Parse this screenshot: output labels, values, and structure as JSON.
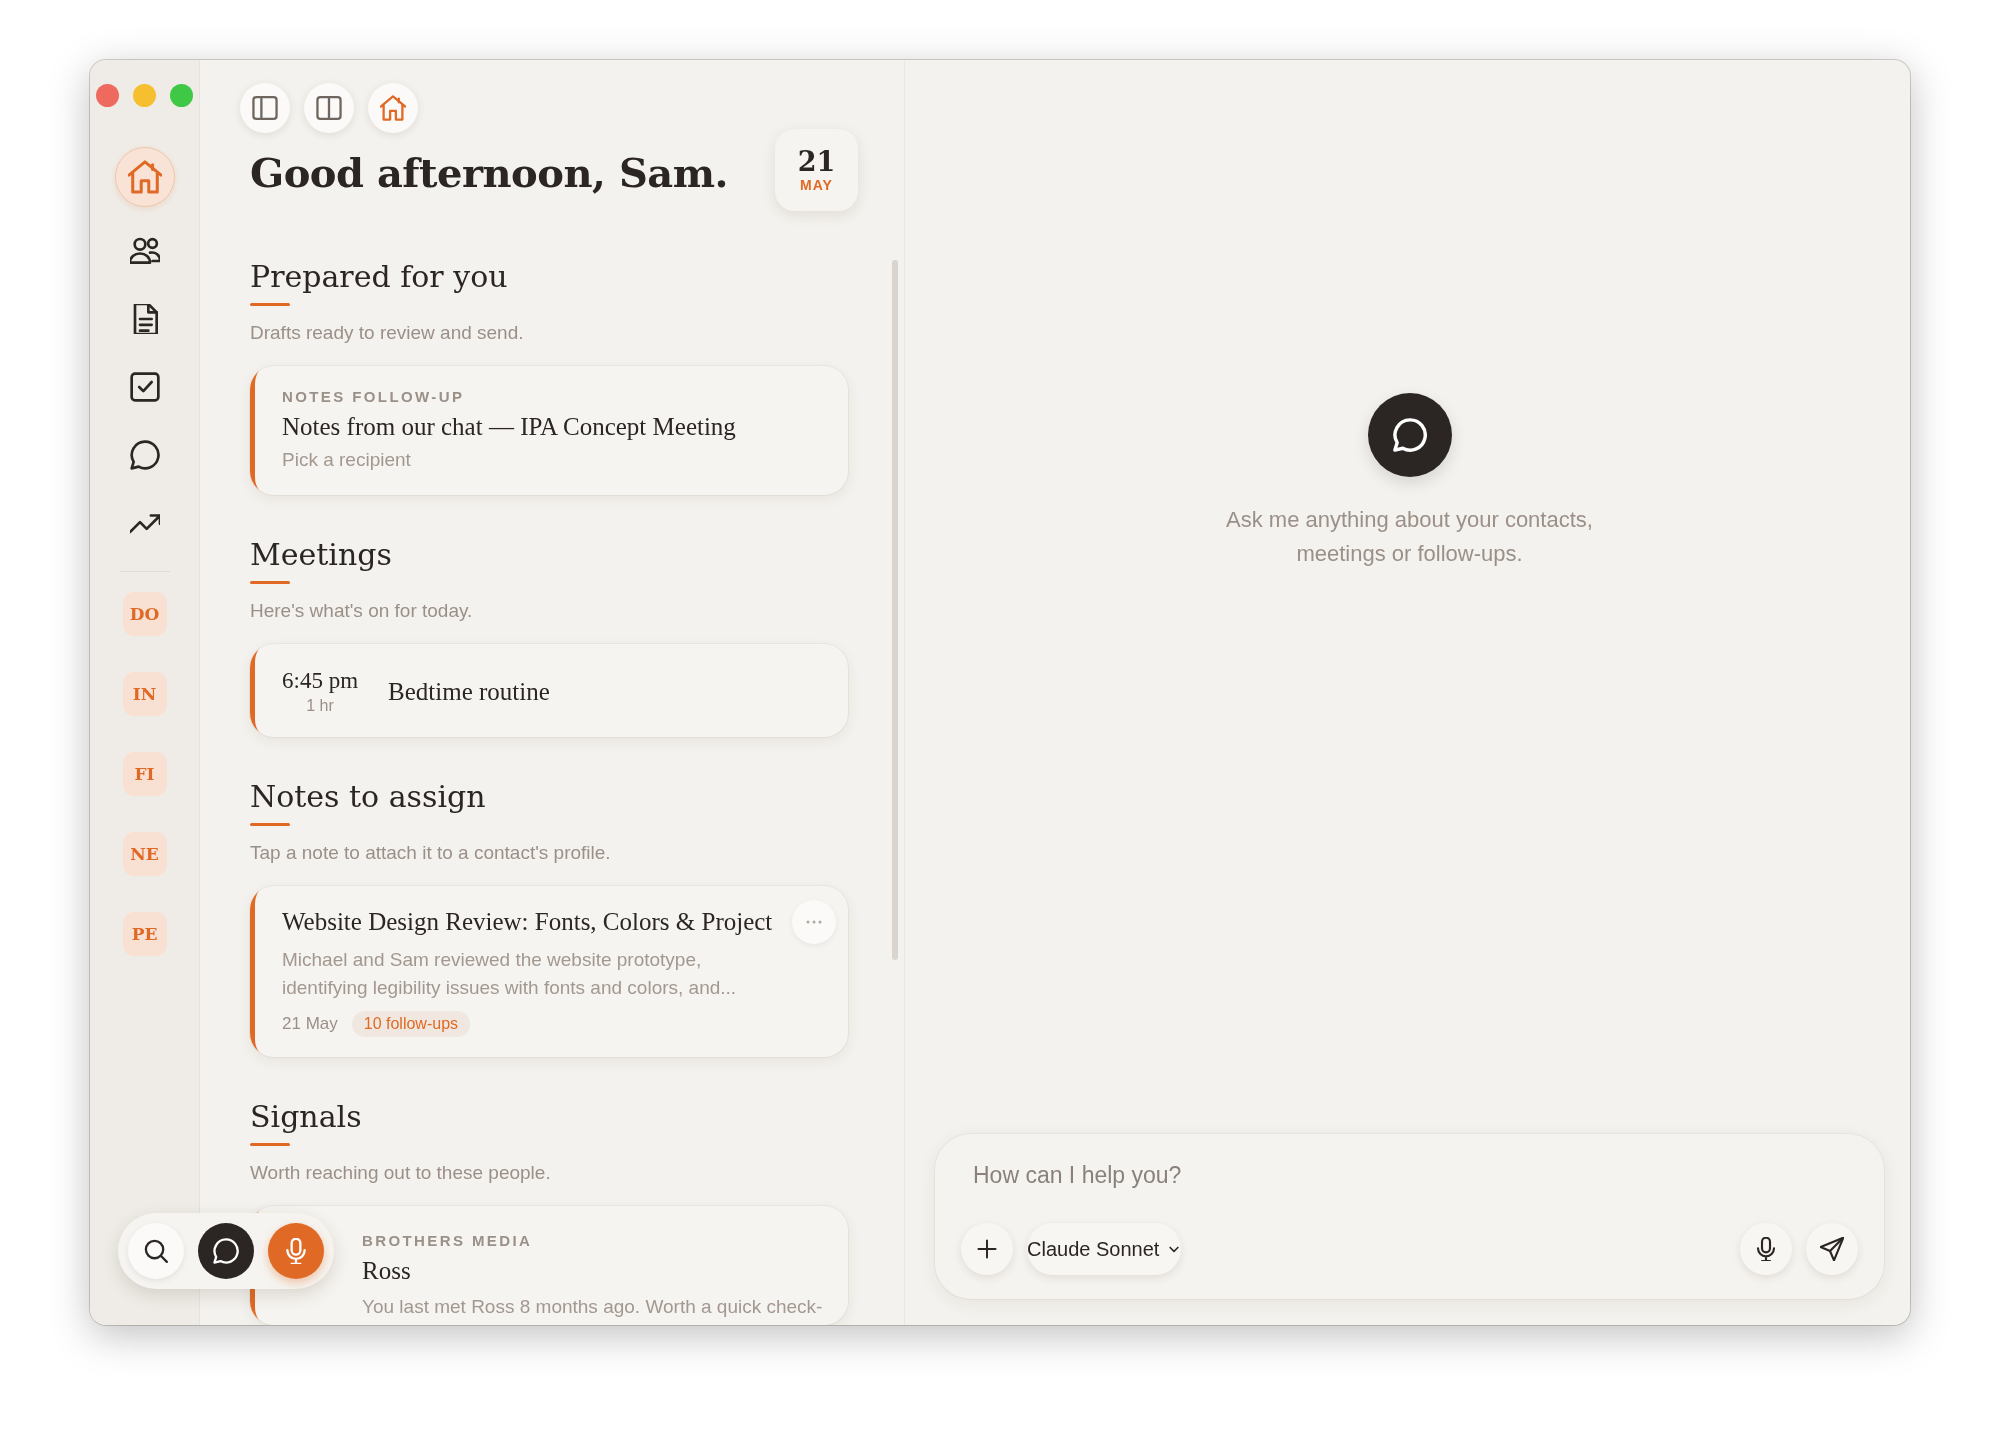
{
  "sidebar": {
    "nav": [
      {
        "kind": "home",
        "selected": true
      },
      {
        "kind": "contacts",
        "selected": false
      },
      {
        "kind": "notes",
        "selected": false
      },
      {
        "kind": "tasks",
        "selected": false
      },
      {
        "kind": "chat",
        "selected": false
      },
      {
        "kind": "trends",
        "selected": false
      }
    ],
    "contacts": [
      {
        "initials": "DO"
      },
      {
        "initials": "IN"
      },
      {
        "initials": "FI"
      },
      {
        "initials": "NE"
      },
      {
        "initials": "PE"
      }
    ]
  },
  "greeting": "Good afternoon, Sam.",
  "date": {
    "day": "21",
    "month": "MAY"
  },
  "sections": [
    {
      "title": "Prepared for you",
      "subtitle": "Drafts ready to review and send.",
      "cards": [
        {
          "kind": "draft",
          "eyebrow": "NOTES FOLLOW-UP",
          "title": "Notes from our chat — IPA Concept Meeting",
          "detail": "Pick a recipient"
        }
      ]
    },
    {
      "title": "Meetings",
      "subtitle": "Here's what's on for today.",
      "cards": [
        {
          "kind": "meeting",
          "time": "6:45 pm",
          "duration": "1 hr",
          "title": "Bedtime routine"
        }
      ]
    },
    {
      "title": "Notes to assign",
      "subtitle": "Tap a note to attach it to a contact's profile.",
      "cards": [
        {
          "kind": "note",
          "title": "Website Design Review: Fonts, Colors & Project",
          "body": "Michael and Sam reviewed the website prototype, identifying legibility issues with fonts and colors, and...",
          "date": "21 May",
          "tag": "10 follow-ups"
        }
      ]
    },
    {
      "title": "Signals",
      "subtitle": "Worth reaching out to these people.",
      "cards": [
        {
          "kind": "signal",
          "eyebrow": "BROTHERS MEDIA",
          "title": "Ross",
          "body": "You last met Ross 8 months ago. Worth a quick check-"
        }
      ]
    }
  ],
  "chat": {
    "prompt": "Ask me anything about your contacts, meetings or follow-ups.",
    "composer": {
      "placeholder": "How can I help you?",
      "model": "Claude Sonnet"
    }
  }
}
